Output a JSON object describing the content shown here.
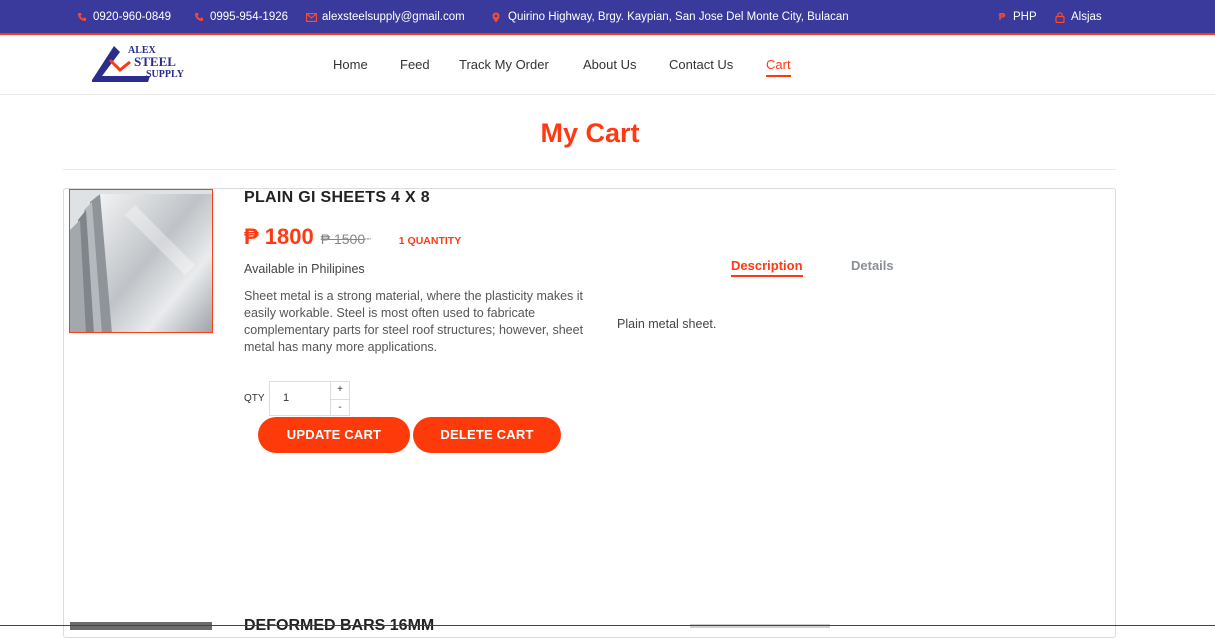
{
  "colors": {
    "accent": "#ff3a12",
    "topbar": "#3a3a9c"
  },
  "topbar": {
    "phone1": "0920-960-0849",
    "phone2": "0995-954-1926",
    "email": "alexsteelsupply@gmail.com",
    "address": "Quirino Highway, Brgy. Kaypian, San Jose Del Monte City, Bulacan",
    "currency": "PHP",
    "user": "Alsjas",
    "icons": [
      "phone-icon",
      "phone-icon",
      "mail-icon",
      "location-pin-icon",
      "peso-icon",
      "user-icon"
    ]
  },
  "logo": {
    "line1": "ALEX",
    "line2": "STEEL",
    "line3": "SUPPLY"
  },
  "nav": [
    {
      "label": "Home"
    },
    {
      "label": "Feed"
    },
    {
      "label": "Track My Order"
    },
    {
      "label": "About Us"
    },
    {
      "label": "Contact Us"
    },
    {
      "label": "Cart",
      "active": true
    }
  ],
  "page": {
    "title": "My Cart"
  },
  "cart_item": {
    "name": "PLAIN GI SHEETS 4 X 8",
    "price": "₱ 1800",
    "old_price": "₱ 1500",
    "old_price_sup": "\"\"",
    "quantity_label": "1 QUANTITY",
    "availability": "Available in Philipines",
    "description": "Sheet metal is a strong material, where the plasticity makes it easily workable. Steel is most often used to fabricate complementary parts for steel roof structures; however, sheet metal has many more applications.",
    "qty_label": "QTY",
    "qty_value": "1",
    "step_up": "+",
    "step_down": "-",
    "update_button": "UPDATE CART",
    "delete_button": "DELETE CART",
    "tabs": [
      {
        "label": "Description",
        "active": true
      },
      {
        "label": "Details",
        "active": false
      }
    ],
    "tab_content": "Plain metal sheet."
  },
  "next_item": {
    "name": "DEFORMED BARS 16MM"
  }
}
